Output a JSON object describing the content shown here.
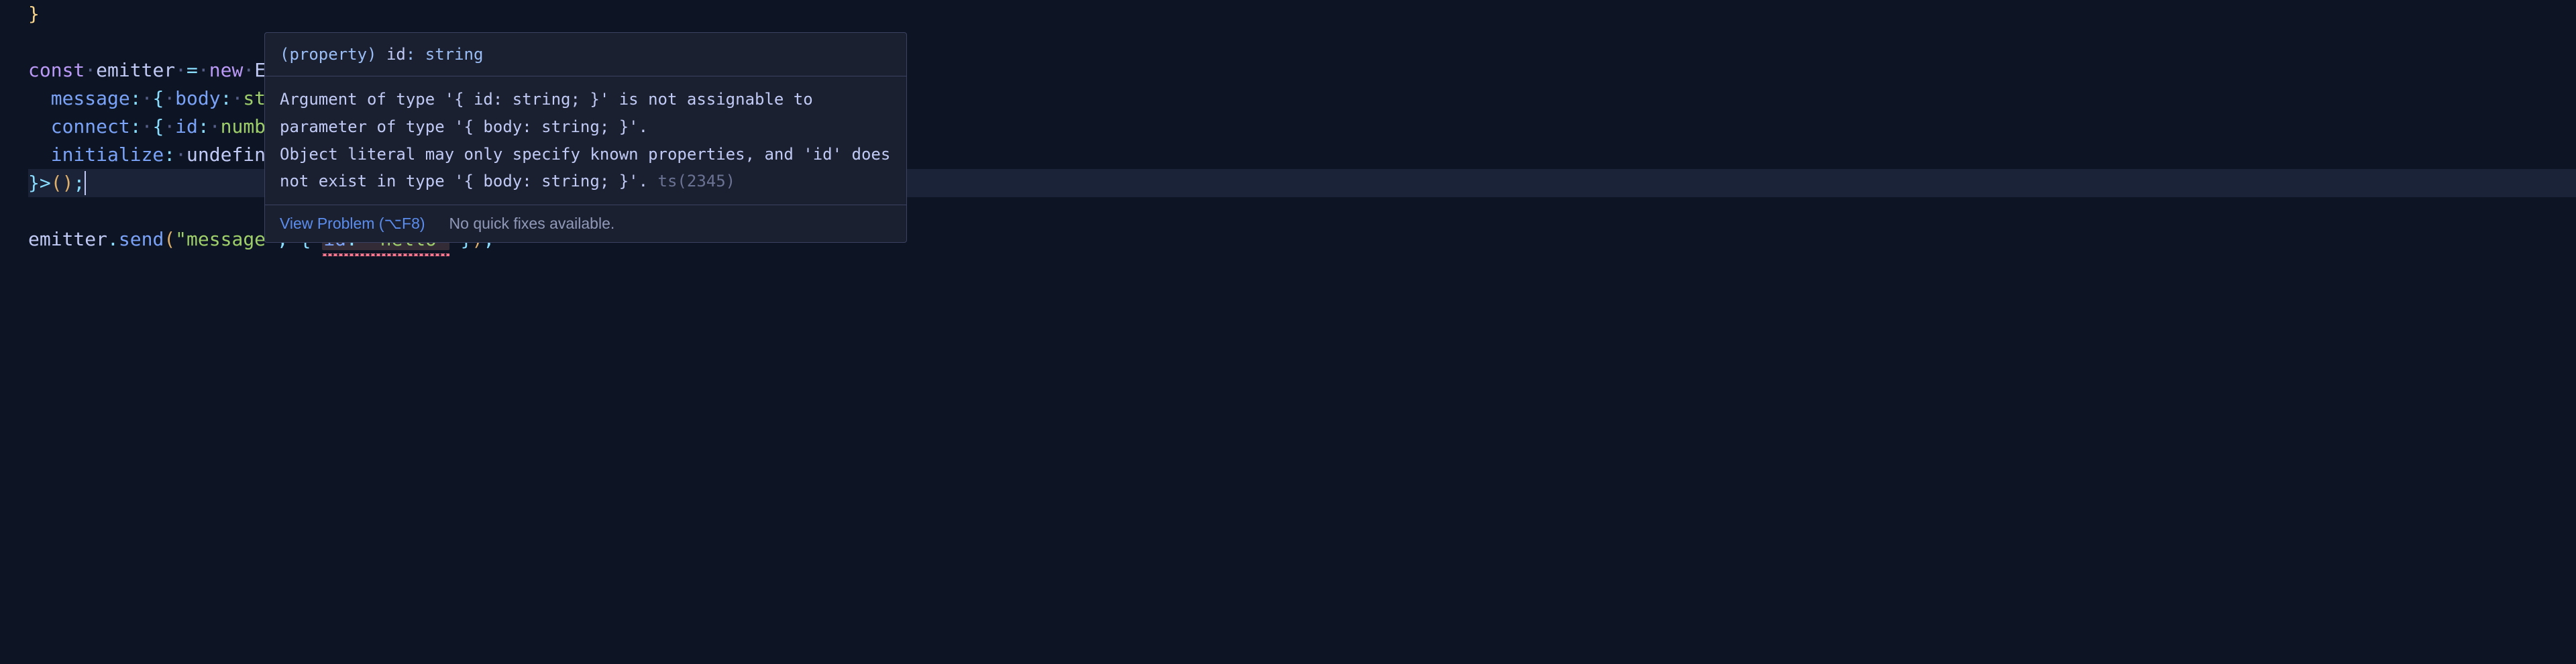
{
  "code": {
    "line1_brace": "}",
    "line3_const": "const",
    "line3_var": "emitter",
    "line3_eq": "=",
    "line3_new": "new",
    "line3_class": "EventE",
    "line4_key": "message",
    "line4_colon": ":",
    "line4_body": "body",
    "line4_type": "string",
    "line5_key": "connect",
    "line5_body": "id",
    "line5_type": "number",
    "line6_key": "initialize",
    "line6_type": "undefined",
    "line7_end": "}>();",
    "line9_obj": "emitter",
    "line9_method": "send",
    "line9_arg1": "\"message\"",
    "line9_prop": "id",
    "line9_val": "\"hello\""
  },
  "tooltip": {
    "signature_prefix": "(property) ",
    "signature_name": "id",
    "signature_suffix": ": string",
    "error_line1": "Argument of type '{ id: string; }' is not assignable to parameter of type '{ body: string; }'.",
    "error_line2": "  Object literal may only specify known properties, and 'id' does not exist in type '{ body: string; }'.",
    "ts_code": "ts(2345)",
    "view_problem": "View Problem (⌥F8)",
    "no_quick_fixes": "No quick fixes available."
  }
}
